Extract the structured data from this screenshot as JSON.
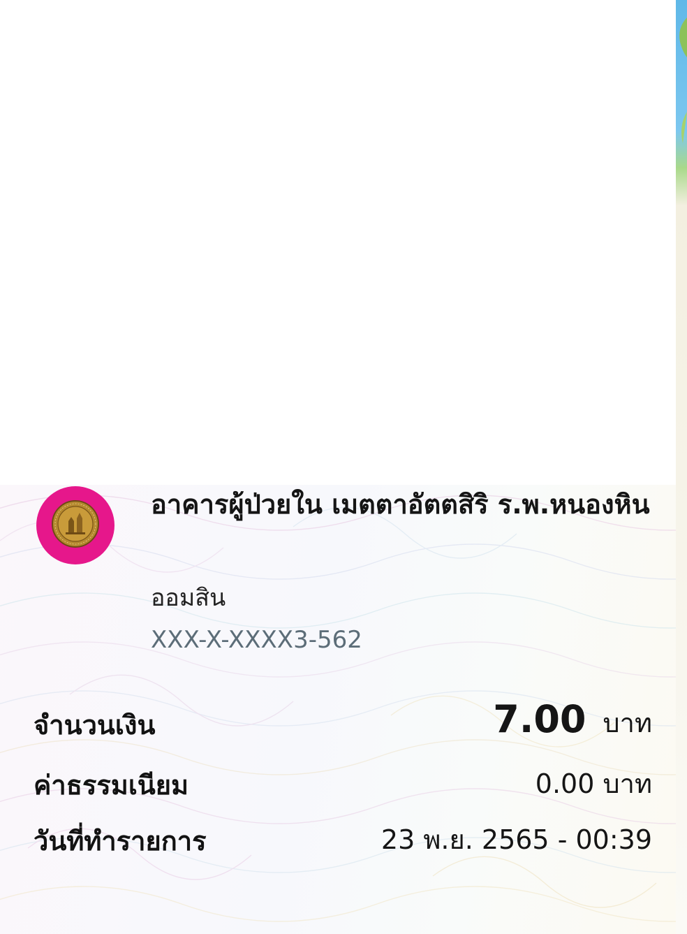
{
  "payee": {
    "name": "อาคารผู้ป่วยใน เมตตาอัตตสิริ ร.พ.หนองหิน",
    "bank": "ออมสิน",
    "account": "XXX-X-XXXX3-562",
    "logo_icon": "gsb-bank-logo-icon",
    "logo_color": "#e6178b"
  },
  "summary": {
    "amount_label": "จำนวนเงิน",
    "amount_value": "7.00",
    "amount_unit": "บาท",
    "fee_label": "ค่าธรรมเนียม",
    "fee_value": "0.00 บาท",
    "date_label": "วันที่ทำรายการ",
    "date_value": "23 พ.ย. 2565 - 00:39"
  }
}
